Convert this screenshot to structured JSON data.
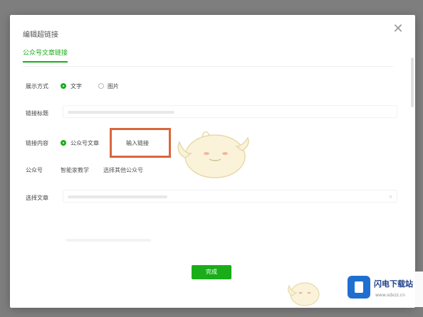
{
  "dialog": {
    "title": "编辑超链接",
    "tab": "公众号文章链接",
    "close_icon": "close-icon"
  },
  "form": {
    "display_mode_label": "展示方式",
    "display_options": [
      "文字",
      "图片"
    ],
    "link_title_label": "链接标题",
    "link_content_label": "链接内容",
    "link_content_options": [
      "公众号文章"
    ],
    "input_link_label": "输入链接",
    "account_label": "公众号",
    "account_value": "智能家教学",
    "account_select": "选择其他公众号",
    "article_label": "选择文章",
    "article_search_icon": "search-icon"
  },
  "footer": {
    "confirm_label": "完成"
  },
  "watermark": {
    "brand": "闪电下载站",
    "url": "www.sdxzz.cn"
  },
  "colors": {
    "accent": "#1aad19",
    "highlight": "#d9663d",
    "badge": "#1f6fd1"
  }
}
